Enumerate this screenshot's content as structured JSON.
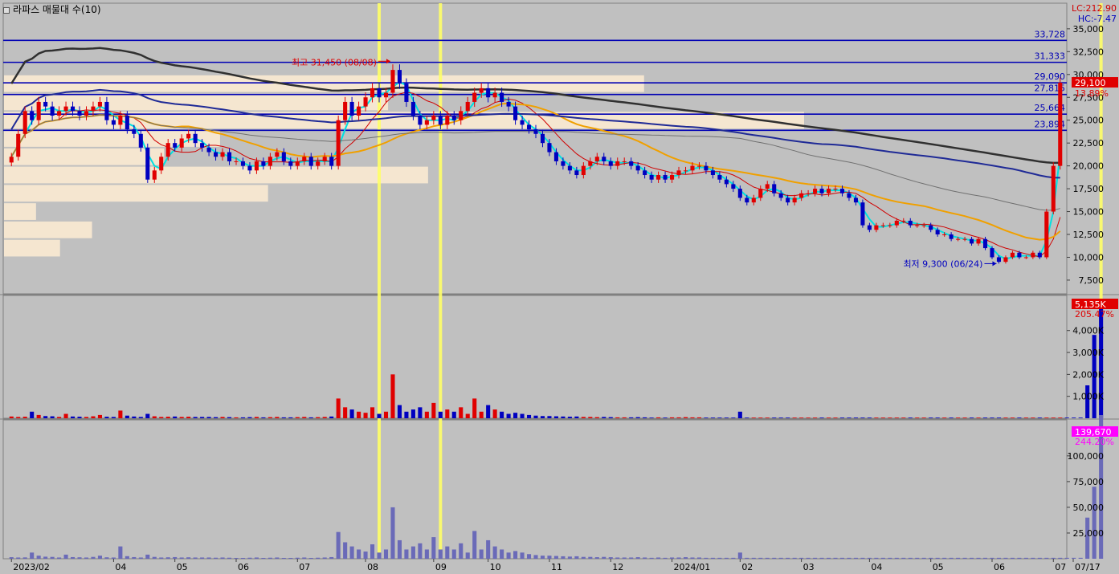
{
  "header": {
    "indicator_title": "라파스 매물대 수(10)",
    "lc_label": "LC:212.90",
    "hc_label": "HC:-7.47"
  },
  "colors": {
    "background": "#c0c0c0",
    "up": "#e00000",
    "down": "#0000c0",
    "hline": "#0000b4",
    "highlight": "#ffff66",
    "volume_profile": "#f5e6d0",
    "ma_black": "#303030",
    "ma_navy": "#1f2a96",
    "ma_gray": "#707070",
    "ma_orange": "#f0a000",
    "ma_red": "#d00000",
    "ma_cyan": "#00e0e0",
    "amount_bar": "#6a6ab8"
  },
  "chart_data": {
    "type": "candlestick",
    "price": {
      "ylim": [
        6000,
        37800
      ],
      "y_ticks": [
        7500,
        10000,
        12500,
        15000,
        17500,
        20000,
        22500,
        25000,
        27500,
        30000,
        32500,
        35000
      ],
      "y_tick_labels": [
        "7,500",
        "10,000",
        "12,500",
        "15,000",
        "17,500",
        "20,000",
        "22,500",
        "25,000",
        "27,500",
        "30,000",
        "32,500",
        "35,000"
      ],
      "levels": [
        33728,
        31333,
        29090,
        27815,
        25664,
        23894
      ],
      "level_labels": [
        "33,728",
        "31,333",
        "29,090",
        "27,815",
        "25,664",
        "23,894"
      ],
      "last_price": 29100,
      "last_price_label": "29,100",
      "last_change_label": "13.89%",
      "high_annotation": "최고 31,450 (08/08)",
      "high_value": 31450,
      "low_annotation": "최저 9,300 (06/24)",
      "low_value": 9300,
      "volume_profile_zones": [
        {
          "low": 28000,
          "high": 30000,
          "strength": 0.8
        },
        {
          "low": 26000,
          "high": 28000,
          "strength": 0.48
        },
        {
          "low": 24000,
          "high": 26000,
          "strength": 1.0
        },
        {
          "low": 22000,
          "high": 24000,
          "strength": 0.27
        },
        {
          "low": 20000,
          "high": 22000,
          "strength": 0.2
        },
        {
          "low": 18000,
          "high": 20000,
          "strength": 0.53
        },
        {
          "low": 16000,
          "high": 18000,
          "strength": 0.33
        },
        {
          "low": 14000,
          "high": 16000,
          "strength": 0.04
        },
        {
          "low": 12000,
          "high": 14000,
          "strength": 0.11
        },
        {
          "low": 10000,
          "high": 12000,
          "strength": 0.07
        }
      ],
      "closes": [
        21000,
        23500,
        26000,
        25000,
        27000,
        26500,
        25500,
        26000,
        26500,
        26000,
        25500,
        26000,
        26500,
        27000,
        25000,
        24500,
        25500,
        24000,
        23500,
        22000,
        18500,
        19500,
        21000,
        22500,
        22000,
        23000,
        23500,
        22500,
        22000,
        21500,
        21000,
        21500,
        20500,
        20500,
        20000,
        19500,
        20500,
        20000,
        21000,
        21500,
        20500,
        20000,
        20500,
        21000,
        20000,
        20500,
        21000,
        20000,
        25000,
        27000,
        25500,
        26500,
        27500,
        28500,
        27500,
        28000,
        30500,
        29000,
        27000,
        25500,
        24500,
        25000,
        25500,
        24500,
        25500,
        25000,
        26000,
        27000,
        28000,
        28500,
        27500,
        28000,
        27000,
        26500,
        25000,
        24500,
        24000,
        23500,
        22500,
        21500,
        20500,
        20000,
        19500,
        19000,
        20000,
        20500,
        21000,
        20500,
        20000,
        20500,
        20500,
        20000,
        19500,
        19000,
        18500,
        19000,
        18500,
        19000,
        19500,
        19500,
        20000,
        20000,
        19500,
        19000,
        18500,
        18000,
        17500,
        16500,
        16000,
        16500,
        17500,
        18000,
        17000,
        16500,
        16000,
        16500,
        17000,
        17000,
        17500,
        17000,
        17500,
        17500,
        17000,
        16500,
        16000,
        13500,
        13000,
        13500,
        13500,
        13500,
        14000,
        14000,
        13500,
        13500,
        13500,
        13000,
        12500,
        12500,
        12000,
        12000,
        12000,
        11500,
        12000,
        11000,
        10000,
        9500,
        10000,
        10500,
        10000,
        10000,
        10500,
        10000,
        15000,
        20000,
        29100
      ],
      "dates_compressed_note": "",
      "highlight_bars": [
        54,
        63,
        160
      ]
    },
    "volume": {
      "ylim": [
        0,
        5600
      ],
      "y_ticks": [
        1000,
        2000,
        3000,
        4000
      ],
      "y_tick_labels": [
        "1,000K",
        "2,000K",
        "3,000K",
        "4,000K"
      ],
      "last_label": "5,135K",
      "last_change_label": "205.47%",
      "values": [
        80,
        60,
        70,
        300,
        150,
        100,
        90,
        60,
        200,
        80,
        70,
        60,
        90,
        150,
        70,
        60,
        350,
        120,
        80,
        60,
        200,
        90,
        60,
        70,
        80,
        60,
        70,
        60,
        60,
        60,
        50,
        60,
        50,
        40,
        40,
        50,
        60,
        40,
        50,
        60,
        40,
        40,
        50,
        60,
        40,
        50,
        60,
        80,
        900,
        500,
        400,
        300,
        250,
        500,
        200,
        300,
        2000,
        600,
        300,
        400,
        500,
        300,
        700,
        300,
        400,
        300,
        500,
        200,
        900,
        300,
        600,
        400,
        300,
        200,
        250,
        200,
        150,
        120,
        100,
        100,
        90,
        80,
        70,
        80,
        60,
        60,
        50,
        60,
        50,
        40,
        40,
        40,
        50,
        40,
        30,
        40,
        30,
        40,
        40,
        50,
        40,
        40,
        30,
        30,
        30,
        30,
        30,
        300,
        30,
        30,
        30,
        30,
        30,
        30,
        30,
        30,
        30,
        30,
        30,
        30,
        30,
        30,
        30,
        30,
        30,
        30,
        30,
        30,
        30,
        30,
        30,
        30,
        30,
        30,
        30,
        30,
        30,
        30,
        30,
        30,
        30,
        30,
        30,
        30,
        30,
        30,
        30,
        30,
        30,
        30,
        30,
        30,
        30,
        30,
        30,
        30,
        30,
        30,
        1500,
        3800,
        5135
      ]
    },
    "amount": {
      "ylim": [
        0,
        135000
      ],
      "y_ticks": [
        25000,
        50000,
        75000,
        100000
      ],
      "y_tick_labels": [
        "25,000",
        "50,000",
        "75,000",
        "100,000"
      ],
      "last_label": "139,670",
      "last_change_label": "244.20%",
      "values": [
        1500,
        1200,
        1300,
        6000,
        3000,
        2000,
        1800,
        1200,
        4000,
        1600,
        1400,
        1200,
        1800,
        3000,
        1400,
        1200,
        12000,
        2500,
        1600,
        1200,
        4000,
        1800,
        1200,
        1400,
        1600,
        1200,
        1400,
        1200,
        1200,
        1200,
        1000,
        1200,
        1000,
        800,
        800,
        1000,
        1200,
        800,
        1000,
        1200,
        800,
        800,
        1000,
        1200,
        800,
        1000,
        1200,
        1600,
        26000,
        16000,
        12000,
        9000,
        7000,
        14000,
        6000,
        9000,
        50000,
        18000,
        9000,
        12000,
        15000,
        9000,
        21000,
        9000,
        12000,
        9000,
        15000,
        6000,
        27000,
        9000,
        18000,
        12000,
        9000,
        6000,
        7500,
        6000,
        4500,
        3600,
        3000,
        3000,
        2700,
        2400,
        2100,
        2400,
        1800,
        1800,
        1500,
        1800,
        1500,
        1200,
        1200,
        1200,
        1500,
        1200,
        900,
        1200,
        900,
        1200,
        1200,
        1500,
        1200,
        1200,
        900,
        900,
        900,
        900,
        900,
        6000,
        900,
        900,
        900,
        900,
        900,
        900,
        900,
        900,
        900,
        900,
        900,
        900,
        900,
        900,
        900,
        900,
        900,
        900,
        900,
        900,
        900,
        900,
        900,
        900,
        900,
        900,
        900,
        900,
        900,
        900,
        900,
        900,
        900,
        900,
        900,
        900,
        900,
        900,
        900,
        900,
        900,
        900,
        900,
        900,
        900,
        900,
        900,
        900,
        900,
        900,
        40000,
        70000,
        139670
      ]
    },
    "x_tick_labels": [
      "2023/02",
      "04",
      "05",
      "06",
      "07",
      "08",
      "09",
      "10",
      "11",
      "12",
      "2024/01",
      "02",
      "03",
      "04",
      "05",
      "06",
      "07",
      "07/17"
    ],
    "x_tick_bars": [
      0,
      15,
      24,
      33,
      42,
      52,
      62,
      70,
      79,
      88,
      97,
      107,
      116,
      126,
      135,
      144,
      153,
      163
    ]
  }
}
